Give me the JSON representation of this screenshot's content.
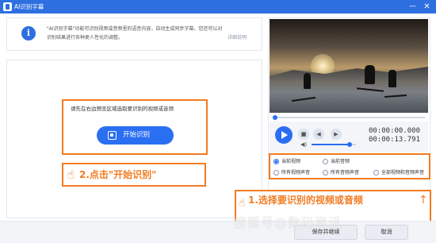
{
  "window": {
    "title": "AI识别字幕"
  },
  "info": {
    "line1": "\"AI识别字幕\"功能可识别视频或音频里的语音内容，自动生成同步字幕。您还可以对",
    "line2": "识别结果进行各种更人性化的调整。",
    "link": "详细说明"
  },
  "main": {
    "hint": "请先在右边预览区域选取要识别的视频或音频",
    "start_button": "开始识别",
    "step2": "2.点击\"开始识别\""
  },
  "player": {
    "progress": 0,
    "volume": 0.85,
    "time_current": "00:00:00.000",
    "time_total": "00:00:13.791"
  },
  "options": {
    "current_video": "当前视频",
    "current_audio": "当前音频",
    "all_video_audio": "所有视频声音",
    "all_audio_audio": "所有音频声音",
    "all_both": "全部视频和音频声音",
    "selected": "current_video"
  },
  "callout": {
    "step1": "1.选择要识别的视频或音频"
  },
  "footer": {
    "save": "保存并继续",
    "cancel": "取消"
  },
  "watermark": "搜狐号@数码资讯",
  "colors": {
    "brand": "#2d6fe0",
    "accent": "#f27b22",
    "button": "#2a6ef2"
  }
}
